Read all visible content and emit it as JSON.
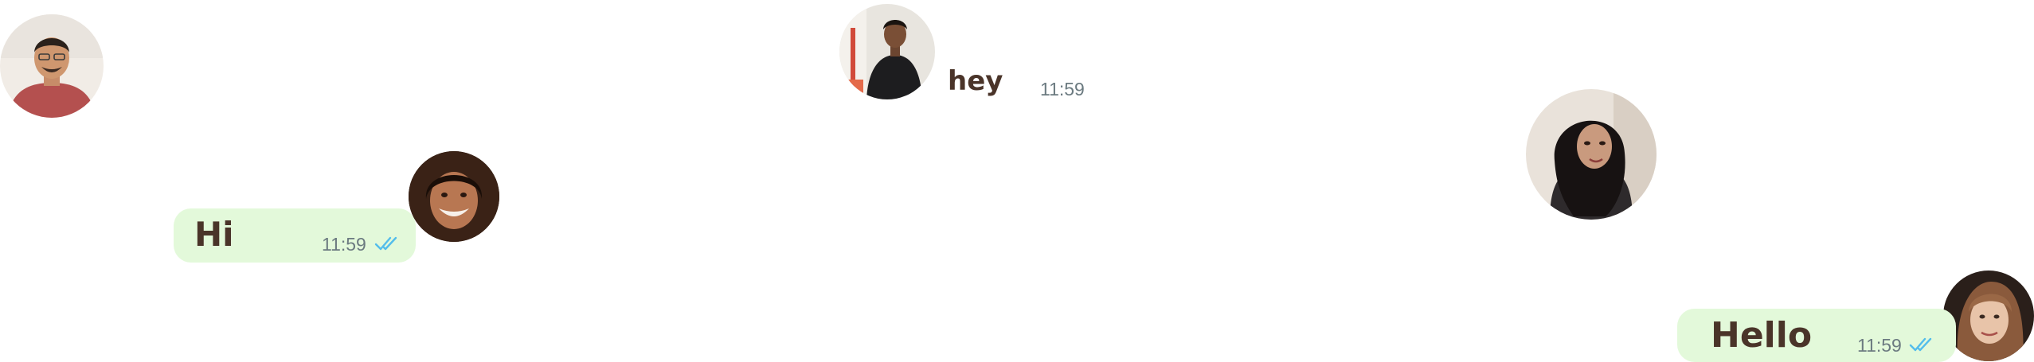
{
  "messages": [
    {
      "id": "hi",
      "text": "Hi",
      "time": "11:59",
      "status": "read"
    },
    {
      "id": "hey",
      "text": "hey",
      "time": "11:59"
    },
    {
      "id": "hello",
      "text": "Hello",
      "time": "11:59",
      "status": "read"
    }
  ],
  "icons": {
    "read_receipt": "double-check-icon",
    "read_color": "#53bdeb"
  },
  "colors": {
    "bubble": "#e3f9da",
    "message_text": "#4a3429",
    "timestamp": "#6b7a80"
  }
}
